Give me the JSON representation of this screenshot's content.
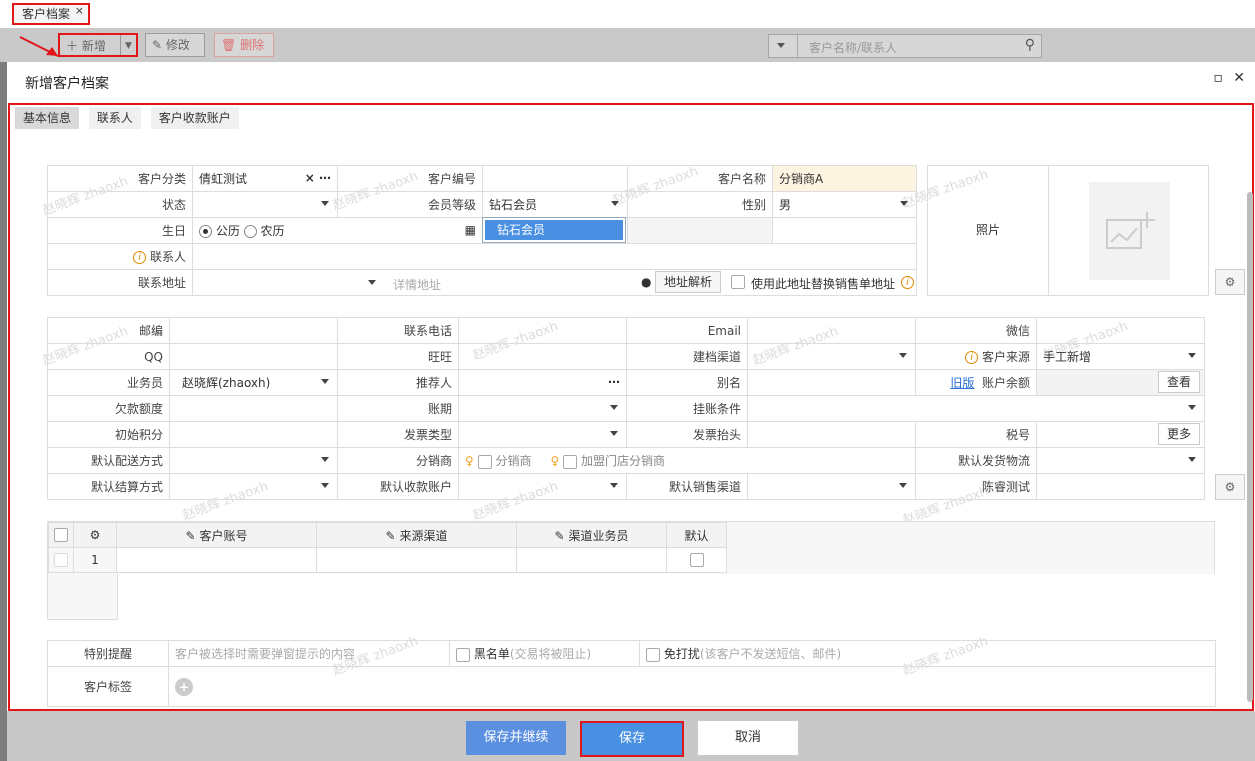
{
  "tab": {
    "label": "客户档案",
    "close": "×"
  },
  "toolbar": {
    "new_label": "新增",
    "edit_label": "修改",
    "delete_label": "删除",
    "search_placeholder": "客户名称/联系人"
  },
  "dialog": {
    "title": "新增客户档案",
    "tabs": [
      "基本信息",
      "联系人",
      "客户收款账户"
    ]
  },
  "basic": {
    "customer_category_label": "客户分类",
    "customer_category_value": "倩虹测试",
    "customer_code_label": "客户编号",
    "customer_name_label": "客户名称",
    "customer_name_value": "分销商A",
    "status_label": "状态",
    "member_level_label": "会员等级",
    "member_level_value": "钻石会员",
    "gender_label": "性别",
    "gender_value": "男",
    "birthday_label": "生日",
    "calendar_solar": "公历",
    "calendar_lunar": "农历",
    "contact_label": "联系人",
    "address_label": "联系地址",
    "address_placeholder": "详情地址",
    "address_parse_button": "地址解析",
    "replace_address_label": "使用此地址替换销售单地址",
    "photo_label": "照片",
    "dropdown_option": "钻石会员"
  },
  "details": {
    "rows": [
      [
        "邮编",
        "",
        "联系电话",
        "",
        "Email",
        "",
        "微信",
        ""
      ],
      [
        "QQ",
        "",
        "旺旺",
        "",
        "建档渠道",
        "",
        "客户来源",
        "手工新增"
      ],
      [
        "业务员",
        "赵晓辉(zhaoxh)",
        "推荐人",
        "",
        "别名",
        "",
        "账户余额",
        ""
      ],
      [
        "欠款额度",
        "",
        "账期",
        "",
        "挂账条件",
        "",
        "",
        ""
      ],
      [
        "初始积分",
        "",
        "发票类型",
        "",
        "发票抬头",
        "",
        "税号",
        ""
      ],
      [
        "默认配送方式",
        "",
        "分销商",
        "",
        "",
        "",
        "默认发货物流",
        ""
      ],
      [
        "默认结算方式",
        "",
        "默认收款账户",
        "",
        "默认销售渠道",
        "",
        "陈睿测试",
        ""
      ]
    ],
    "old_version_link": "旧版",
    "view_button": "查看",
    "more_button": "更多",
    "distributor_option1": "分销商",
    "distributor_option2": "加盟门店分销商"
  },
  "grid": {
    "headers": [
      "客户账号",
      "来源渠道",
      "渠道业务员",
      "默认"
    ],
    "row_index": "1"
  },
  "extra": {
    "special_reminder_label": "特别提醒",
    "special_reminder_placeholder": "客户被选择时需要弹窗提示的内容",
    "blacklist_label": "黑名单",
    "blacklist_hint": "(交易将被阻止)",
    "no_disturb_label": "免打扰",
    "no_disturb_hint": "(该客户不发送短信、邮件)",
    "tags_label": "客户标签"
  },
  "footer": {
    "save_continue": "保存并继续",
    "save": "保存",
    "cancel": "取消"
  },
  "watermark": "赵晓辉 zhaoxh",
  "colors": {
    "accent": "#4a90e2",
    "highlight": "#e0161b",
    "name_bg": "#fdf3e1"
  }
}
